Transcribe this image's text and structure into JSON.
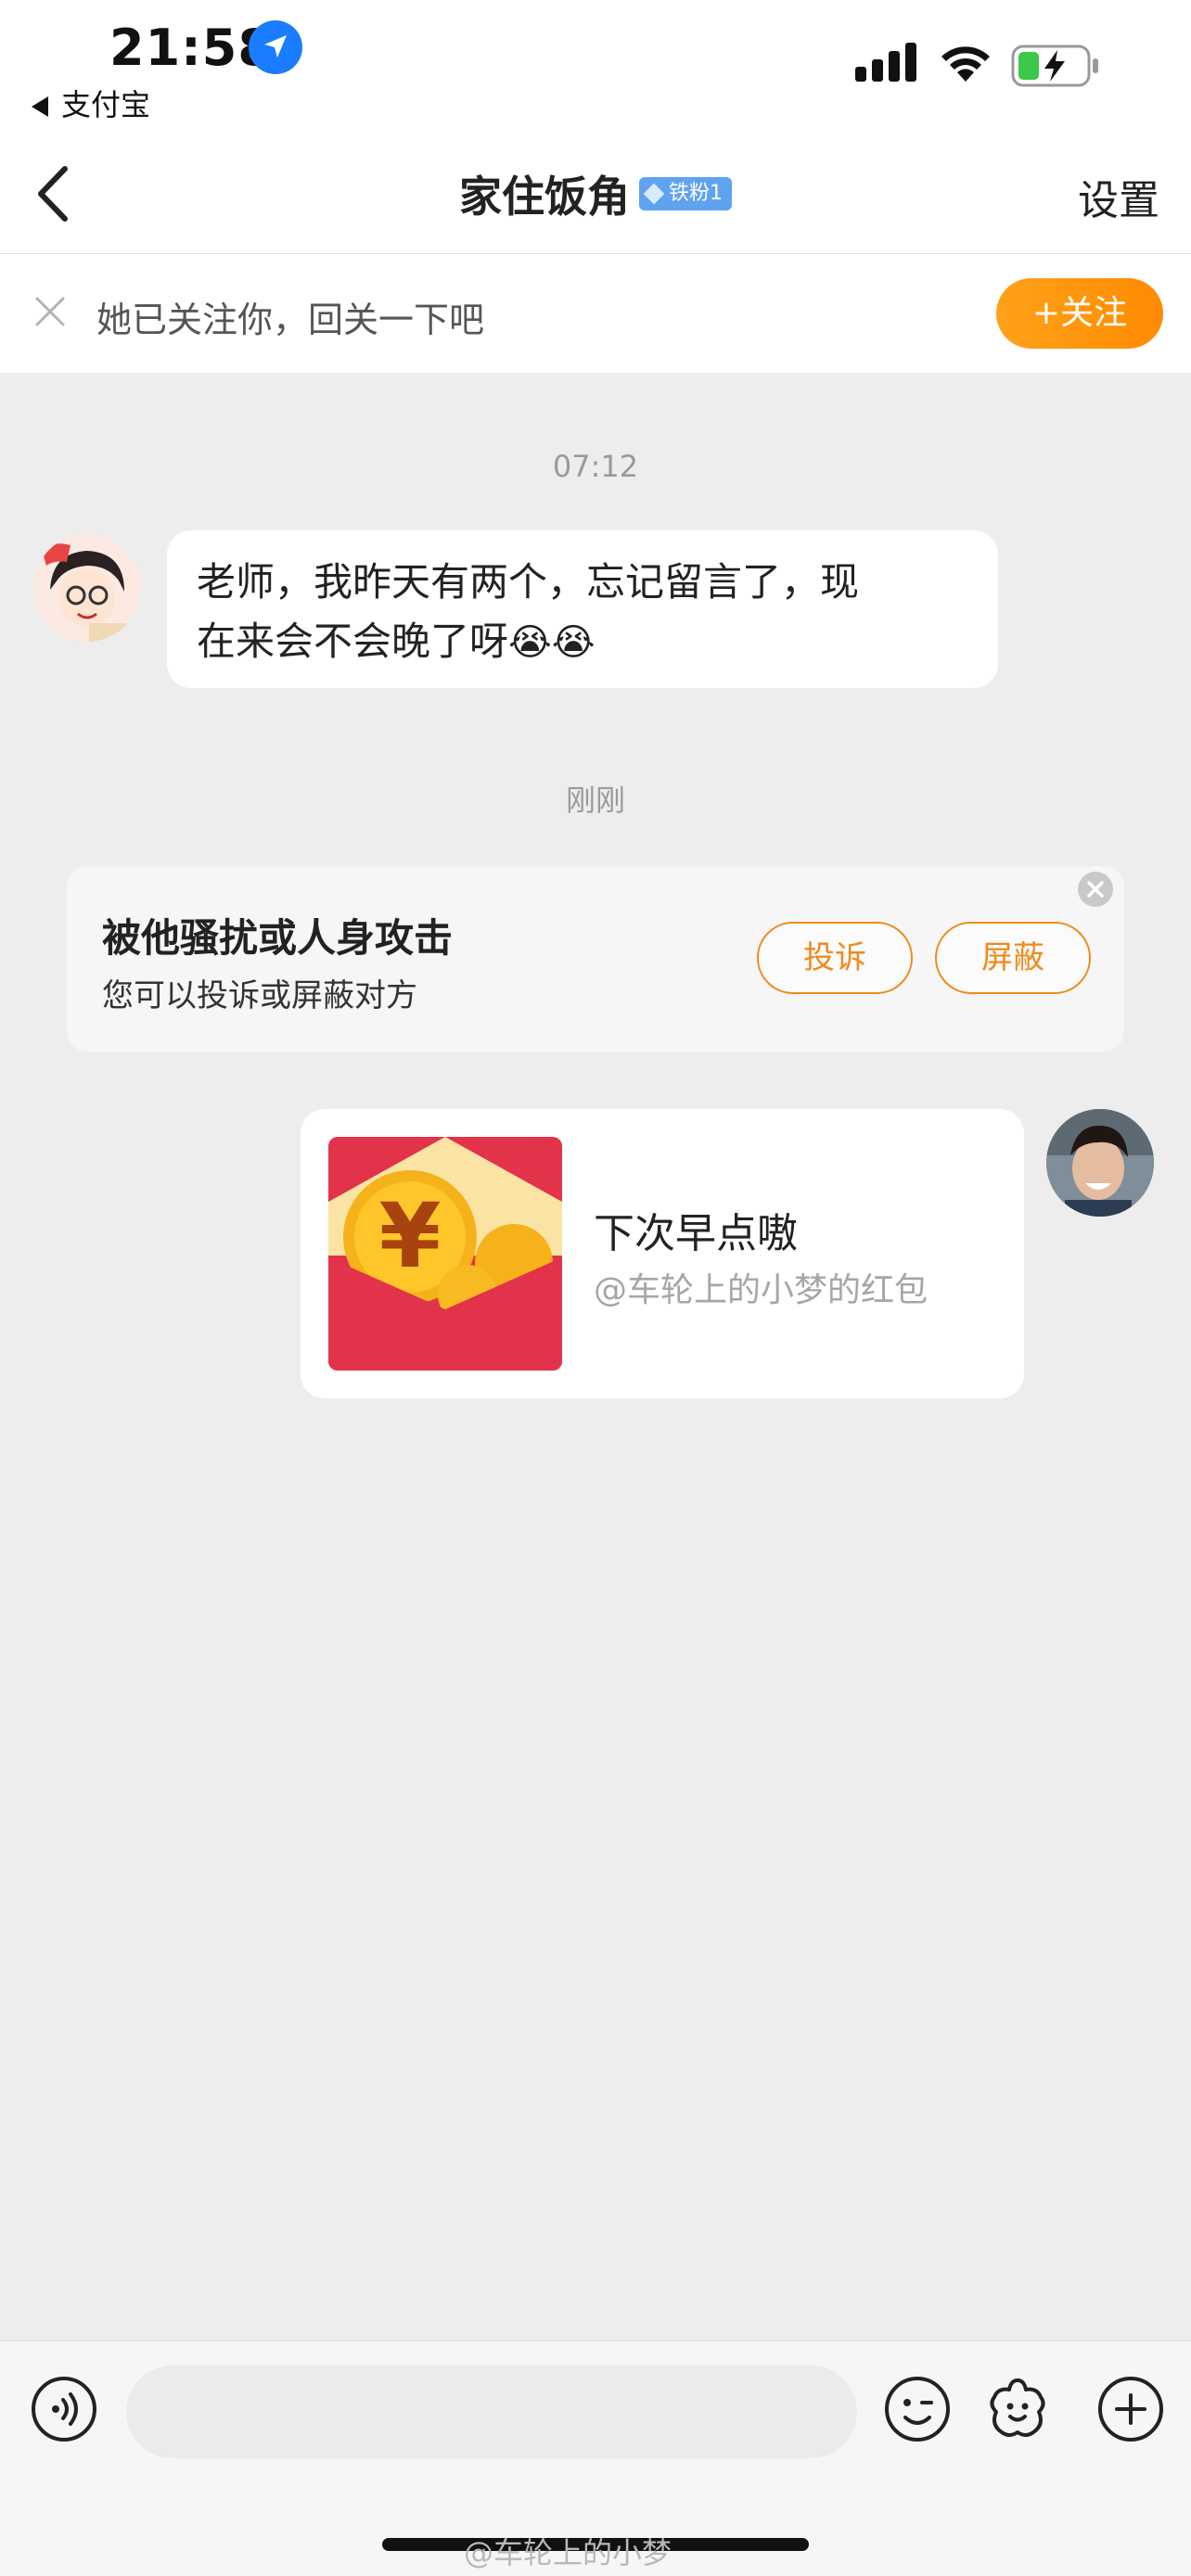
{
  "status_bar": {
    "time": "21:58",
    "back_app": "支付宝",
    "icons": [
      "location-arrow-icon",
      "cellular-signal-icon",
      "wifi-icon",
      "battery-charging-icon"
    ]
  },
  "nav": {
    "title": "家住饭角",
    "fan_badge": "铁粉1",
    "settings": "设置",
    "back_icon": "chevron-left-icon"
  },
  "follow_banner": {
    "text": "她已关注你，回关一下吧",
    "button": "+关注",
    "close_icon": "close-icon"
  },
  "messages": {
    "time_1": "07:12",
    "incoming_text": "老师，我昨天有两个，忘记留言了，现在来会不会晚了呀",
    "incoming_line1": "老师，我昨天有两个，忘记留言了，现",
    "incoming_line2": "在来会不会晚了呀",
    "incoming_emoji": "😭😭",
    "time_2": "刚刚"
  },
  "warning": {
    "title": "被他骚扰或人身攻击",
    "subtitle": "您可以投诉或屏蔽对方",
    "complain": "投诉",
    "block": "屏蔽"
  },
  "red_packet": {
    "title": "下次早点嗷",
    "from": "@车轮上的小梦的红包"
  },
  "input_bar": {
    "icons": [
      "voice-icon",
      "emoji-icon",
      "sticker-icon",
      "add-icon"
    ]
  },
  "watermark": "@车轮上的小梦",
  "colors": {
    "accent_orange": "#ff8a00",
    "badge_blue": "#5fa3f0",
    "red_packet": "#e2334a",
    "location_blue": "#1a7cff"
  }
}
